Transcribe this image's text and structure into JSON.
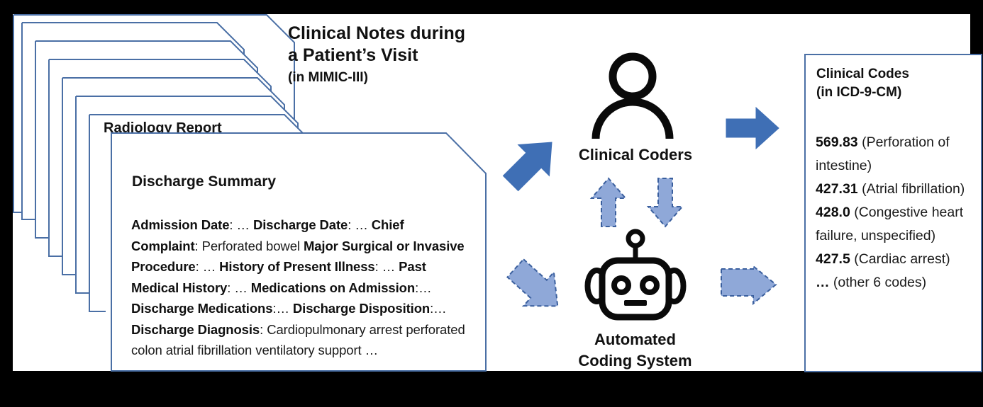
{
  "canvas": {
    "background": "#ffffff",
    "outer_background": "#000000",
    "accent_blue": "#4a6fa5",
    "solid_arrow_color": "#3f6fb5",
    "dashed_arrow_fill": "#8fa8d8",
    "dashed_arrow_stroke": "#4a6fa5"
  },
  "headline": {
    "line1": "Clinical Notes during",
    "line2": "a Patient’s Visit",
    "line3": "(in MIMIC-III)"
  },
  "documents": {
    "stack_count": 7,
    "radiology_title": "Radiology Report",
    "discharge_title": "Discharge Summary",
    "discharge_body": [
      {
        "bold": "Admission Date",
        "plain": ":  … "
      },
      {
        "bold": "Discharge Date",
        "plain": ":   … "
      },
      {
        "bold": "Chief Complaint",
        "plain": ": Perforated bowel "
      },
      {
        "bold": "Major Surgical or Invasive Procedure",
        "plain": ": … "
      },
      {
        "bold": "History of Present Illness",
        "plain": ": … "
      },
      {
        "bold": "Past Medical History",
        "plain": ": … "
      },
      {
        "bold": "Medications on Admission",
        "plain": ":… "
      },
      {
        "bold": "Discharge Medications",
        "plain": ":… "
      },
      {
        "bold": "Discharge Disposition",
        "plain": ":… "
      },
      {
        "bold": "Discharge Diagnosis",
        "plain": ": Cardiopulmonary arrest perforated colon atrial fibrillation ventilatory support …"
      }
    ]
  },
  "actors": {
    "human_label": "Clinical Coders",
    "human_icon": "person-icon",
    "machine_label_line1": "Automated",
    "machine_label_line2": "Coding System",
    "machine_icon": "robot-icon"
  },
  "arrows": {
    "notes_to_coders": {
      "name": "arrow-notes-to-coders",
      "style": "solid",
      "direction": "up-right"
    },
    "notes_to_system": {
      "name": "arrow-notes-to-system",
      "style": "dashed",
      "direction": "down-right"
    },
    "coders_to_codes": {
      "name": "arrow-coders-to-codes",
      "style": "solid",
      "direction": "right"
    },
    "system_to_codes": {
      "name": "arrow-system-to-codes",
      "style": "dashed",
      "direction": "right"
    },
    "system_to_coders": {
      "name": "arrow-system-to-coders",
      "style": "dashed",
      "direction": "up"
    },
    "coders_to_system": {
      "name": "arrow-coders-to-system",
      "style": "dashed",
      "direction": "down"
    }
  },
  "codes": {
    "title_line1": "Clinical Codes",
    "title_line2": "(in ICD-9-CM)",
    "items": [
      {
        "code": "569.83",
        "description": "(Perforation of intestine)"
      },
      {
        "code": "427.31",
        "description": "(Atrial fibrillation)"
      },
      {
        "code": "428.0",
        "description": "(Congestive heart failure, unspecified)"
      },
      {
        "code": "427.5",
        "description": "(Cardiac arrest)"
      },
      {
        "code": "…",
        "description": "(other 6 codes)"
      }
    ]
  }
}
